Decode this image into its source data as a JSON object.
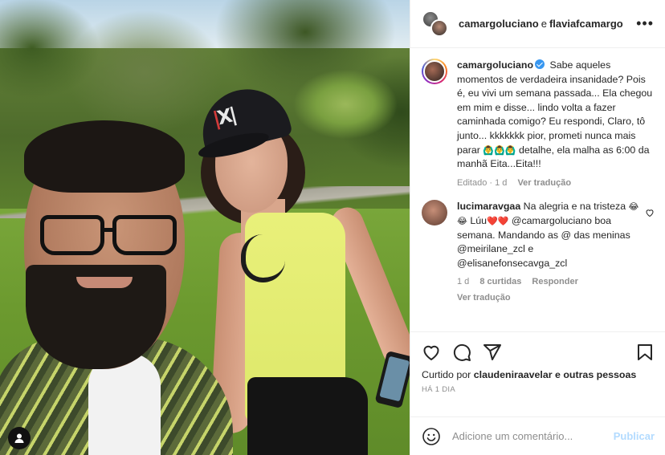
{
  "header": {
    "user1": "camargoluciano",
    "conjunction": "e",
    "user2": "flaviafcamargo",
    "more_icon": "more-horizontal-icon"
  },
  "caption": {
    "username": "camargoluciano",
    "text": "Sabe aqueles momentos de verdadeira insanidade? Pois é, eu vivi um semana passada... Ela chegou em mim e disse... lindo volta a fazer caminhada comigo? Eu respondi, Claro, tô junto... kkkkkkk pior, prometi nunca mais parar",
    "text_end": "detalhe, ela malha as 6:00 da manhã Eita...Eita!!!",
    "edited": "Editado · 1 d",
    "see_translation": "Ver tradução"
  },
  "comments": [
    {
      "username": "lucimaravgaa",
      "part1": "Na alegria e na tristeza",
      "part2": "Lúu",
      "part3": "@camargoluciano boa semana. Mandando as @ das meninas @meirilane_zcl e @elisanefonsecavga_zcl",
      "age": "1 d",
      "likes": "8 curtidas",
      "reply": "Responder",
      "see_translation": "Ver tradução"
    }
  ],
  "likes": {
    "prefix": "Curtido por",
    "user": "claudeniraavelar",
    "suffix": "e outras pessoas"
  },
  "timestamp": "HÁ 1 DIA",
  "add_comment": {
    "placeholder": "Adicione um comentário...",
    "publish_label": "Publicar"
  },
  "colors": {
    "verified": "#3897f0",
    "heart_red": "#e0161f",
    "publish_disabled": "#b3dbff"
  }
}
